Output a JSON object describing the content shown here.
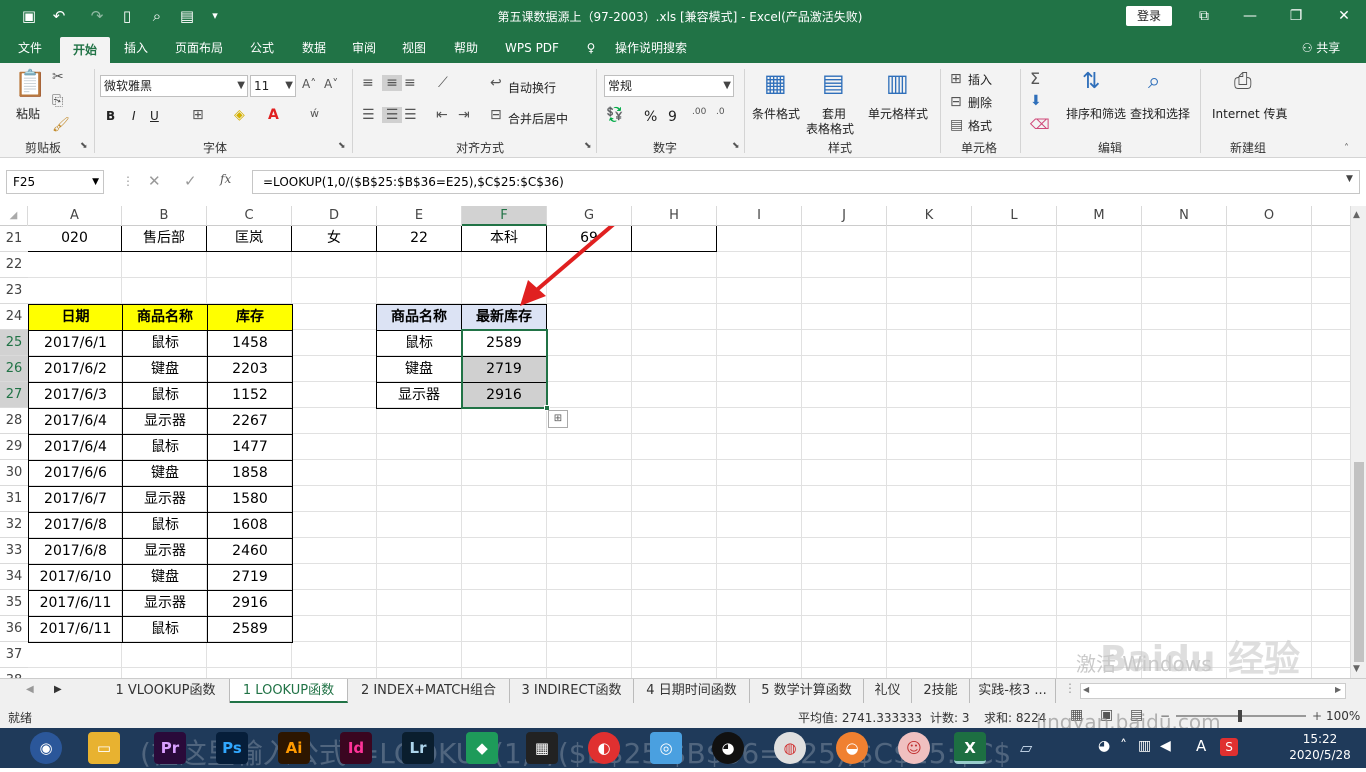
{
  "titlebar": {
    "document_title": "第五课数据源上（97-2003）.xls  [兼容模式]  -  Excel(产品激活失败)",
    "login": "登录"
  },
  "menu": {
    "tabs": [
      "文件",
      "开始",
      "插入",
      "页面布局",
      "公式",
      "数据",
      "审阅",
      "视图",
      "帮助",
      "WPS PDF",
      "操作说明搜索"
    ],
    "share": "共享"
  },
  "ribbon": {
    "clipboard": {
      "paste": "粘贴",
      "label": "剪贴板"
    },
    "font": {
      "name": "微软雅黑",
      "size": "11",
      "bold": "B",
      "italic": "I",
      "underline": "U",
      "label": "字体"
    },
    "alignment": {
      "wrap": "自动换行",
      "merge": "合并后居中",
      "label": "对齐方式"
    },
    "number": {
      "format": "常规",
      "percent": "%",
      "comma": "9",
      "label": "数字"
    },
    "styles": {
      "conditional": "条件格式",
      "table1": "套用",
      "table2": "表格格式",
      "cell": "单元格样式",
      "label": "样式"
    },
    "cells": {
      "insert": "插入",
      "delete": "删除",
      "format": "格式",
      "label": "单元格"
    },
    "editing": {
      "sort": "排序和筛选",
      "find": "查找和选择",
      "label": "编辑"
    },
    "newgroup": {
      "fax": "Internet 传真",
      "label": "新建组"
    }
  },
  "formula_bar": {
    "name_box": "F25",
    "fx": "fx",
    "formula": "=LOOKUP(1,0/($B$25:$B$36=E25),$C$25:$C$36)"
  },
  "columns": [
    "A",
    "B",
    "C",
    "D",
    "E",
    "F",
    "G",
    "H",
    "I",
    "J",
    "K",
    "L",
    "M",
    "N",
    "O"
  ],
  "rows": [
    "21",
    "22",
    "23",
    "24",
    "25",
    "26",
    "27",
    "28",
    "29",
    "30",
    "31",
    "32",
    "33",
    "34",
    "35",
    "36",
    "37",
    "38"
  ],
  "row21": [
    "020",
    "售后部",
    "匡岚",
    "女",
    "22",
    "本科",
    "69"
  ],
  "left_table": {
    "headers": [
      "日期",
      "商品名称",
      "库存"
    ],
    "rows": [
      [
        "2017/6/1",
        "鼠标",
        "1458"
      ],
      [
        "2017/6/2",
        "键盘",
        "2203"
      ],
      [
        "2017/6/3",
        "鼠标",
        "1152"
      ],
      [
        "2017/6/4",
        "显示器",
        "2267"
      ],
      [
        "2017/6/4",
        "鼠标",
        "1477"
      ],
      [
        "2017/6/6",
        "键盘",
        "1858"
      ],
      [
        "2017/6/7",
        "显示器",
        "1580"
      ],
      [
        "2017/6/8",
        "鼠标",
        "1608"
      ],
      [
        "2017/6/8",
        "显示器",
        "2460"
      ],
      [
        "2017/6/10",
        "键盘",
        "2719"
      ],
      [
        "2017/6/11",
        "显示器",
        "2916"
      ],
      [
        "2017/6/11",
        "鼠标",
        "2589"
      ]
    ]
  },
  "right_table": {
    "headers": [
      "商品名称",
      "最新库存"
    ],
    "rows": [
      [
        "鼠标",
        "2589"
      ],
      [
        "键盘",
        "2719"
      ],
      [
        "显示器",
        "2916"
      ]
    ]
  },
  "sheet_tabs": [
    "1 VLOOKUP函数",
    "1 LOOKUP函数",
    "2 INDEX+MATCH组合",
    "3 INDIRECT函数",
    "4 日期时间函数",
    "5 数学计算函数",
    "礼仪",
    "2技能",
    "实践-核3 ..."
  ],
  "status": {
    "ready": "就绪",
    "average": "平均值: 2741.333333",
    "count": "计数: 3",
    "sum": "求和: 8224",
    "zoom": "100%"
  },
  "taskbar": {
    "time": "15:22",
    "date": "2020/5/28",
    "overlay_text": "(在这里输入公式 =LOOKUP(1,0/($B$25:$B$36=E25),$C$25:$C$"
  },
  "watermark": {
    "line1": "激活 Windows",
    "line2": "Baidu 经验",
    "line3": "jingyan.baidu.com"
  },
  "colors": {
    "excel_green": "#217346",
    "header_yellow": "#ffff00",
    "header_lavender": "#dce3f4",
    "selected_gray": "#d0d0d0",
    "arrow_red": "#e02020"
  }
}
